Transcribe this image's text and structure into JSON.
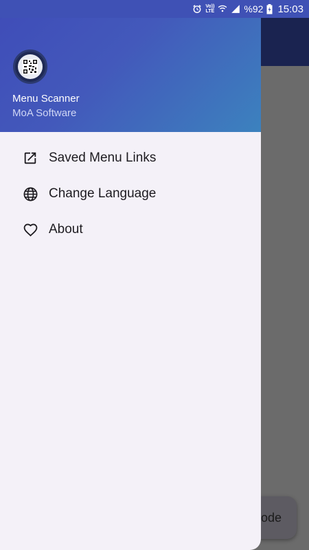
{
  "status_bar": {
    "volte_line1": "Vo))",
    "volte_line2": "LTE",
    "battery": "%92",
    "time": "15:03"
  },
  "drawer": {
    "header": {
      "app_name": "Menu Scanner",
      "developer": "MoA Software"
    },
    "items": [
      {
        "label": "Saved Menu Links",
        "icon": "open-in-new-icon"
      },
      {
        "label": "Change Language",
        "icon": "globe-icon"
      },
      {
        "label": "About",
        "icon": "heart-icon"
      }
    ]
  },
  "background": {
    "fab_label": "ode"
  },
  "colors": {
    "header_start": "#3f4cb8",
    "header_end": "#3c82be",
    "drawer_bg": "#f4f1f8",
    "scrim": "#6b6b6b"
  }
}
